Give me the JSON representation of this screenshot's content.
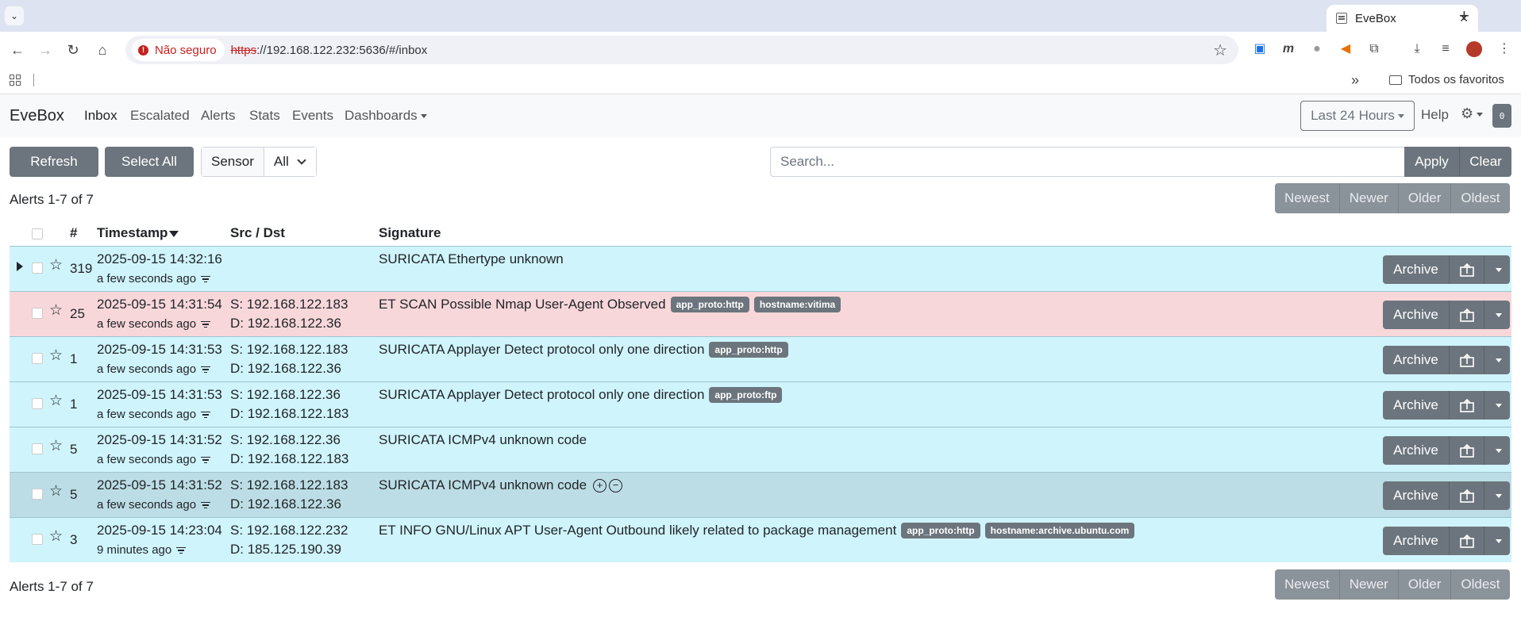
{
  "browser": {
    "tab_title": "EveBox",
    "insecure_label": "Não seguro",
    "url_scheme": "https",
    "url_rest": "://192.168.122.232:5636/#/inbox",
    "bookmarks_folder": "Todos os favoritos"
  },
  "nav": {
    "brand": "EveBox",
    "links": [
      "Inbox",
      "Escalated",
      "Alerts",
      "Stats",
      "Events",
      "Dashboards"
    ],
    "time_range": "Last 24 Hours",
    "help": "Help",
    "badge": "0"
  },
  "controls": {
    "refresh": "Refresh",
    "select_all": "Select All",
    "sensor_label": "Sensor",
    "sensor_value": "All",
    "search_placeholder": "Search...",
    "apply": "Apply",
    "clear": "Clear"
  },
  "pager": {
    "count_text": "Alerts 1-7 of 7",
    "newest": "Newest",
    "newer": "Newer",
    "older": "Older",
    "oldest": "Oldest"
  },
  "table": {
    "headers": {
      "count": "#",
      "timestamp": "Timestamp",
      "srcdst": "Src / Dst",
      "signature": "Signature"
    },
    "archive_label": "Archive",
    "rows": [
      {
        "count": "319",
        "timestamp": "2025-09-15 14:32:16",
        "ago": "a few seconds ago",
        "src": "",
        "dst": "",
        "signature": "SURICATA Ethertype unknown",
        "tags": []
      },
      {
        "count": "25",
        "timestamp": "2025-09-15 14:31:54",
        "ago": "a few seconds ago",
        "src": "S: 192.168.122.183",
        "dst": "D: 192.168.122.36",
        "signature": "ET SCAN Possible Nmap User-Agent Observed",
        "tags": [
          "app_proto:http",
          "hostname:vitima"
        ]
      },
      {
        "count": "1",
        "timestamp": "2025-09-15 14:31:53",
        "ago": "a few seconds ago",
        "src": "S: 192.168.122.183",
        "dst": "D: 192.168.122.36",
        "signature": "SURICATA Applayer Detect protocol only one direction",
        "tags": [
          "app_proto:http"
        ]
      },
      {
        "count": "1",
        "timestamp": "2025-09-15 14:31:53",
        "ago": "a few seconds ago",
        "src": "S: 192.168.122.36",
        "dst": "D: 192.168.122.183",
        "signature": "SURICATA Applayer Detect protocol only one direction",
        "tags": [
          "app_proto:ftp"
        ]
      },
      {
        "count": "5",
        "timestamp": "2025-09-15 14:31:52",
        "ago": "a few seconds ago",
        "src": "S: 192.168.122.36",
        "dst": "D: 192.168.122.183",
        "signature": "SURICATA ICMPv4 unknown code",
        "tags": []
      },
      {
        "count": "5",
        "timestamp": "2025-09-15 14:31:52",
        "ago": "a few seconds ago",
        "src": "S: 192.168.122.183",
        "dst": "D: 192.168.122.36",
        "signature": "SURICATA ICMPv4 unknown code",
        "tags": []
      },
      {
        "count": "3",
        "timestamp": "2025-09-15 14:23:04",
        "ago": "9 minutes ago",
        "src": "S: 192.168.122.232",
        "dst": "D: 185.125.190.39",
        "signature": "ET INFO GNU/Linux APT User-Agent Outbound likely related to package management",
        "tags": [
          "app_proto:http",
          "hostname:archive.ubuntu.com"
        ]
      }
    ]
  },
  "colors": {
    "info_row": "#cff4fc",
    "danger_row": "#f8d7da",
    "hover_row": "#bcdde5",
    "button": "#6c757d"
  }
}
